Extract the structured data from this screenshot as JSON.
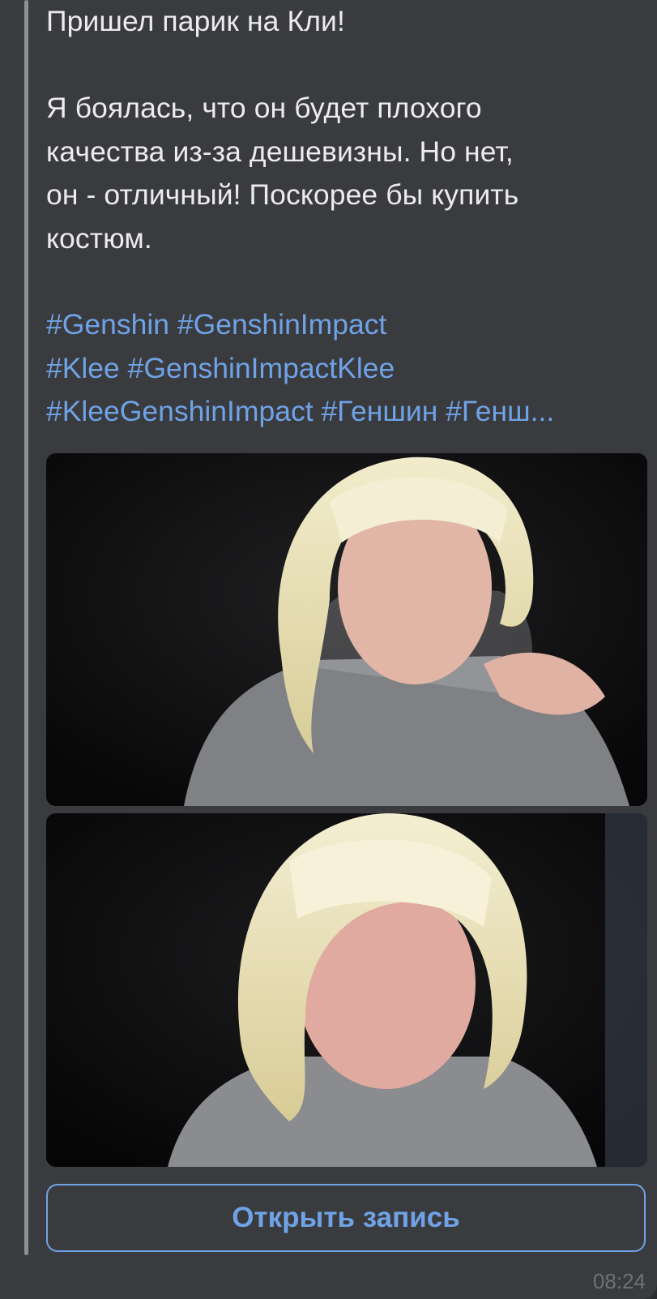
{
  "post": {
    "title_line": "Пришел парик на Кли!",
    "body": "Я боялась, что он будет плохого\nкачества из-за дешевизны. Но нет,\nон - отличный! Поскорее бы купить\nкостюм.",
    "hashtags": {
      "line1": [
        "#Genshin",
        "#GenshinImpact"
      ],
      "line2": [
        "#Klee",
        "#GenshinImpactKlee"
      ],
      "line3": [
        "#KleeGenshinImpact",
        "#Геншин",
        "#Генш..."
      ]
    },
    "photos": [
      {
        "label": "photo-1"
      },
      {
        "label": "photo-2"
      }
    ],
    "open_button_label": "Открыть запись",
    "timestamp": "08:24"
  },
  "colors": {
    "background": "#2b2c2f",
    "bubble": "#3a3b3f",
    "text": "#ececec",
    "link": "#6fa3e6",
    "timestamp": "#6e7075",
    "quote_bar": "#8e9095"
  }
}
